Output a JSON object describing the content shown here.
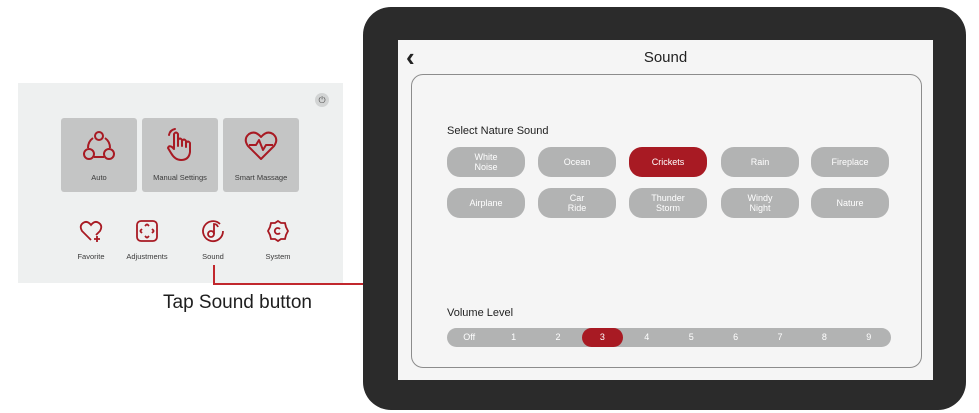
{
  "home": {
    "power_icon": "power-icon",
    "tiles": [
      {
        "label": "Auto",
        "icon": "auto-nodes-icon"
      },
      {
        "label": "Manual Settings",
        "icon": "hand-touch-icon"
      },
      {
        "label": "Smart Massage",
        "icon": "heart-pulse-icon"
      }
    ],
    "shortcuts": [
      {
        "label": "Favorite",
        "icon": "heart-plus-icon"
      },
      {
        "label": "Adjustments",
        "icon": "adjust-arrows-icon"
      },
      {
        "label": "Sound",
        "icon": "sound-note-icon"
      },
      {
        "label": "System",
        "icon": "gear-icon"
      }
    ]
  },
  "callout": {
    "text": "Tap Sound button"
  },
  "sound_screen": {
    "title": "Sound",
    "back_icon": "chevron-left-icon",
    "nature_label": "Select Nature Sound",
    "sounds": [
      {
        "label": "White\nNoise",
        "active": false
      },
      {
        "label": "Ocean",
        "active": false
      },
      {
        "label": "Crickets",
        "active": true
      },
      {
        "label": "Rain",
        "active": false
      },
      {
        "label": "Fireplace",
        "active": false
      },
      {
        "label": "Airplane",
        "active": false
      },
      {
        "label": "Car\nRide",
        "active": false
      },
      {
        "label": "Thunder\nStorm",
        "active": false
      },
      {
        "label": "Windy\nNight",
        "active": false
      },
      {
        "label": "Nature",
        "active": false
      }
    ],
    "volume_label": "Volume Level",
    "volume_levels": [
      "Off",
      "1",
      "2",
      "3",
      "4",
      "5",
      "6",
      "7",
      "8",
      "9"
    ],
    "volume_selected": "3"
  },
  "colors": {
    "accent": "#a81a23",
    "pill": "#b2b3b3",
    "tablet": "#2b2b2b"
  }
}
